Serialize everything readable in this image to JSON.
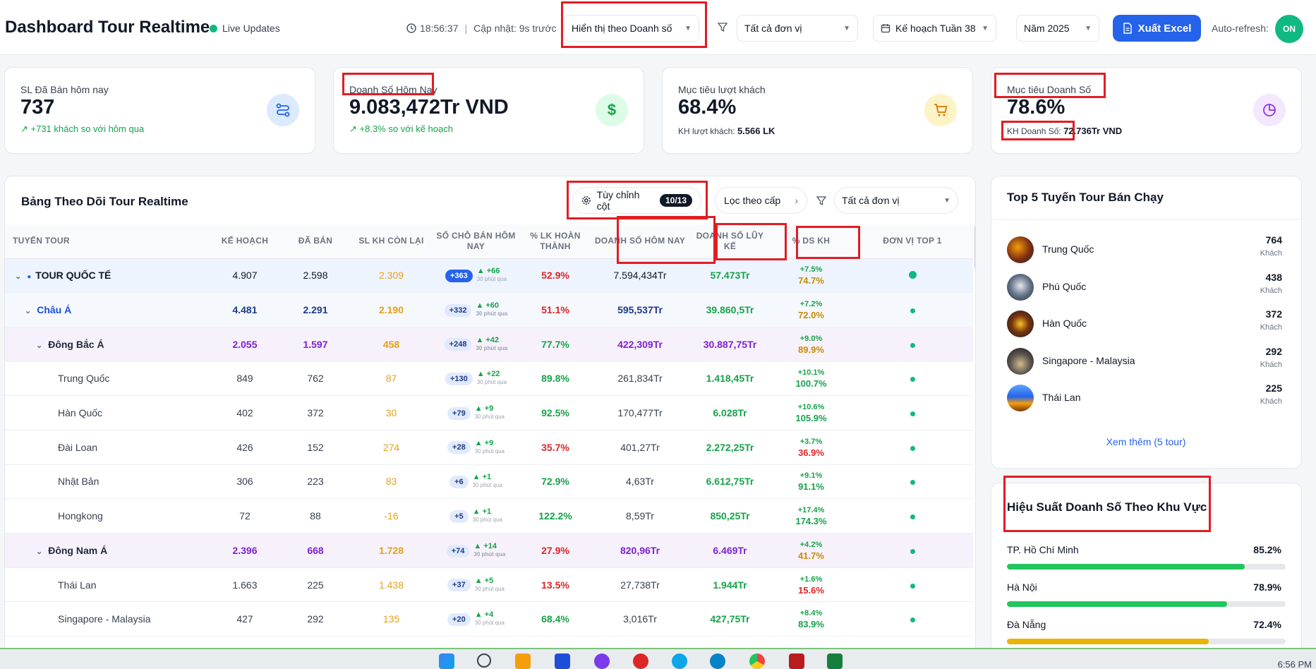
{
  "header": {
    "title": "Dashboard Tour Realtime",
    "live_label": "Live Updates",
    "time": "18:56:37",
    "updated": "Cập nhật: 9s trước",
    "display_select": "Hiển thị theo Doanh số",
    "unit_select": "Tất cả đơn vị",
    "plan_select": "Kế hoạch Tuần 38",
    "year_select": "Năm 2025",
    "export_label": "Xuất Excel",
    "autorefresh_label": "Auto-refresh:",
    "autorefresh_state": "ON"
  },
  "cards": [
    {
      "label": "SL Đã Bán hôm nay",
      "value": "737",
      "sub": "+731 khách so với hôm qua",
      "icon": "route-icon"
    },
    {
      "label": "Doanh Số Hôm Nay",
      "value": "9.083,472Tr VND",
      "sub": "+8.3% so với kế hoạch",
      "icon": "dollar-icon"
    },
    {
      "label": "Mục tiêu lượt khách",
      "value": "68.4%",
      "sub_label": "KH lượt khách:",
      "sub_value": "5.566 LK",
      "icon": "cart-icon"
    },
    {
      "label": "Mục tiêu Doanh Số",
      "value": "78.6%",
      "sub_label": "KH Doanh Số:",
      "sub_value": "72.736Tr VND",
      "icon": "pie-icon"
    }
  ],
  "table_panel": {
    "title": "Bảng Theo Dõi Tour Realtime",
    "customize_label": "Tùy chỉnh cột",
    "customize_badge": "10/13",
    "filter_level_label": "Lọc theo cấp",
    "unit_filter": "Tất cả đơn vị",
    "columns": [
      "Tuyến Tour",
      "Kế Hoạch",
      "Đã Bán",
      "SL KH Còn Lại",
      "Số chỗ bán hôm nay",
      "% LK Hoàn Thành",
      "Doanh Số Hôm Nay",
      "Doanh Số Lũy Kế",
      "% DS KH",
      "Đơn vị Top 1"
    ],
    "delta_time": "30 phút qua",
    "rows": [
      {
        "name": "TOUR QUỐC TẾ",
        "plan": "4.907",
        "sold": "2.598",
        "remain": "2.309",
        "today": "+363",
        "delta": "▲ +66",
        "lk": "52.9%",
        "ds_today": "7.594,434Tr",
        "ds_lk": "57.473Tr",
        "ds_kh_delta": "+7.5%",
        "ds_kh": "74.7%"
      },
      {
        "name": "Châu Á",
        "plan": "4.481",
        "sold": "2.291",
        "remain": "2.190",
        "today": "+332",
        "delta": "▲ +60",
        "lk": "51.1%",
        "ds_today": "595,537Tr",
        "ds_lk": "39.860,5Tr",
        "ds_kh_delta": "+7.2%",
        "ds_kh": "72.0%"
      },
      {
        "name": "Đông Bắc Á",
        "plan": "2.055",
        "sold": "1.597",
        "remain": "458",
        "today": "+248",
        "delta": "▲ +42",
        "lk": "77.7%",
        "ds_today": "422,309Tr",
        "ds_lk": "30.887,75Tr",
        "ds_kh_delta": "+9.0%",
        "ds_kh": "89.9%"
      },
      {
        "name": "Trung Quốc",
        "plan": "849",
        "sold": "762",
        "remain": "87",
        "today": "+130",
        "delta": "▲ +22",
        "lk": "89.8%",
        "ds_today": "261,834Tr",
        "ds_lk": "1.418,45Tr",
        "ds_kh_delta": "+10.1%",
        "ds_kh": "100.7%"
      },
      {
        "name": "Hàn Quốc",
        "plan": "402",
        "sold": "372",
        "remain": "30",
        "today": "+79",
        "delta": "▲ +9",
        "lk": "92.5%",
        "ds_today": "170,477Tr",
        "ds_lk": "6.028Tr",
        "ds_kh_delta": "+10.6%",
        "ds_kh": "105.9%"
      },
      {
        "name": "Đài Loan",
        "plan": "426",
        "sold": "152",
        "remain": "274",
        "today": "+28",
        "delta": "▲ +9",
        "lk": "35.7%",
        "ds_today": "401,27Tr",
        "ds_lk": "2.272,25Tr",
        "ds_kh_delta": "+3.7%",
        "ds_kh": "36.9%"
      },
      {
        "name": "Nhật Bản",
        "plan": "306",
        "sold": "223",
        "remain": "83",
        "today": "+6",
        "delta": "▲ +1",
        "lk": "72.9%",
        "ds_today": "4,63Tr",
        "ds_lk": "6.612,75Tr",
        "ds_kh_delta": "+9.1%",
        "ds_kh": "91.1%"
      },
      {
        "name": "Hongkong",
        "plan": "72",
        "sold": "88",
        "remain": "-16",
        "today": "+5",
        "delta": "▲ +1",
        "lk": "122.2%",
        "ds_today": "8,59Tr",
        "ds_lk": "850,25Tr",
        "ds_kh_delta": "+17.4%",
        "ds_kh": "174.3%"
      },
      {
        "name": "Đông Nam Á",
        "plan": "2.396",
        "sold": "668",
        "remain": "1.728",
        "today": "+74",
        "delta": "▲ +14",
        "lk": "27.9%",
        "ds_today": "820,96Tr",
        "ds_lk": "6.469Tr",
        "ds_kh_delta": "+4.2%",
        "ds_kh": "41.7%"
      },
      {
        "name": "Thái Lan",
        "plan": "1.663",
        "sold": "225",
        "remain": "1.438",
        "today": "+37",
        "delta": "▲ +5",
        "lk": "13.5%",
        "ds_today": "27,738Tr",
        "ds_lk": "1.944Tr",
        "ds_kh_delta": "+1.6%",
        "ds_kh": "15.6%"
      },
      {
        "name": "Singapore - Malaysia",
        "plan": "427",
        "sold": "292",
        "remain": "135",
        "today": "+20",
        "delta": "▲ +4",
        "lk": "68.4%",
        "ds_today": "3,016Tr",
        "ds_lk": "427,75Tr",
        "ds_kh_delta": "+8.4%",
        "ds_kh": "83.9%"
      }
    ]
  },
  "top5": {
    "title": "Top 5 Tuyến Tour Bán Chạy",
    "unit": "Khách",
    "items": [
      {
        "name": "Trung Quốc",
        "value": "764"
      },
      {
        "name": "Phú Quốc",
        "value": "438"
      },
      {
        "name": "Hàn Quốc",
        "value": "372"
      },
      {
        "name": "Singapore - Malaysia",
        "value": "292"
      },
      {
        "name": "Thái Lan",
        "value": "225"
      }
    ],
    "more": "Xem thêm (5 tour)"
  },
  "regions": {
    "title": "Hiệu Suất Doanh Số Theo Khu Vực",
    "items": [
      {
        "name": "TP. Hồ Chí Minh",
        "value": "85.2%",
        "pct": 85.2,
        "color": "#22c55e"
      },
      {
        "name": "Hà Nội",
        "value": "78.9%",
        "pct": 78.9,
        "color": "#22c55e"
      },
      {
        "name": "Đà Nẵng",
        "value": "72.4%",
        "pct": 72.4,
        "color": "#eab308"
      }
    ]
  },
  "taskbar": {
    "time": "6:56 PM"
  }
}
